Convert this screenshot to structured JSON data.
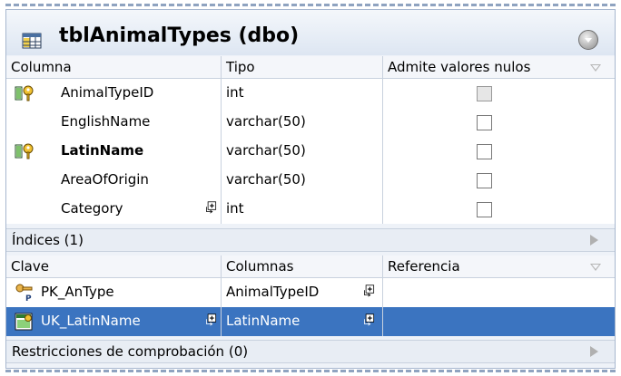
{
  "window": {
    "title": "tblAnimalTypes (dbo)",
    "icon": "table-icon"
  },
  "columns_header": {
    "columna": "Columna",
    "tipo": "Tipo",
    "nulos": "Admite valores nulos"
  },
  "columns": [
    {
      "name": "AnimalTypeID",
      "type": "int",
      "key": true,
      "bold": false,
      "nullable": false,
      "disabled": true
    },
    {
      "name": "EnglishName",
      "type": "varchar(50)",
      "key": false,
      "bold": false,
      "nullable": false
    },
    {
      "name": "LatinName",
      "type": "varchar(50)",
      "key": true,
      "bold": true,
      "nullable": false
    },
    {
      "name": "AreaOfOrigin",
      "type": "varchar(50)",
      "key": false,
      "bold": false,
      "nullable": false
    },
    {
      "name": "Category",
      "type": "int",
      "key": false,
      "bold": false,
      "nullable": false,
      "expandable": true
    }
  ],
  "indices_section": {
    "label": "Índices (1)"
  },
  "indices_header": {
    "clave": "Clave",
    "columnas": "Columnas",
    "referencia": "Referencia"
  },
  "indices": [
    {
      "key": "PK_AnType",
      "columns": "AnimalTypeID",
      "reference": "",
      "icon": "primary-key-icon"
    },
    {
      "key": "UK_LatinName",
      "columns": "LatinName",
      "reference": "",
      "icon": "unique-key-icon",
      "selected": true
    }
  ],
  "checks_section": {
    "label": "Restricciones de comprobación (0)"
  }
}
